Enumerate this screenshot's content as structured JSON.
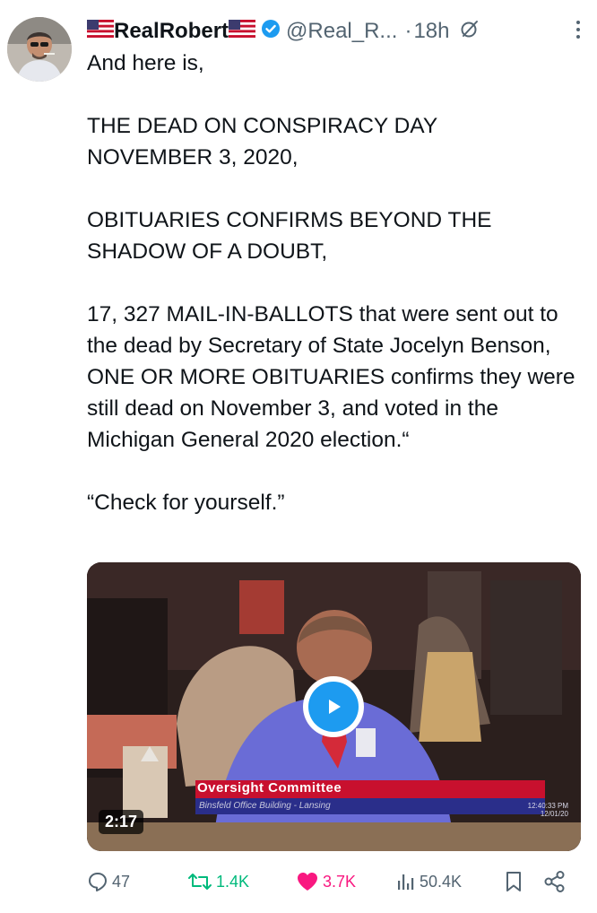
{
  "post": {
    "author": {
      "display_name": "RealRobert",
      "handle": "@Real_R...",
      "time": "18h",
      "separator": "·"
    },
    "text": {
      "line1": "And here is,",
      "para2": "THE DEAD ON CONSPIRACY DAY NOVEMBER 3, 2020,",
      "para3": "OBITUARIES CONFIRMS BEYOND THE SHADOW OF A DOUBT,",
      "para4": "17, 327 MAIL-IN-BALLOTS that were sent out to the dead by Secretary of State Jocelyn Benson, ONE OR MORE OBITUARIES confirms they were still dead on November 3, and voted in the Michigan General 2020 election.“",
      "para5": "“Check for yourself.”"
    },
    "video": {
      "duration": "2:17",
      "overlay_title": "Oversight Committee",
      "overlay_subtitle": "Binsfeld Office Building - Lansing",
      "overlay_clock": "12:40:33 PM",
      "overlay_date": "12/01/20"
    },
    "actions": {
      "replies": "47",
      "reposts": "1.4K",
      "likes": "3.7K",
      "views": "50.4K"
    }
  },
  "colors": {
    "text": "#0f1419",
    "muted": "#536471",
    "verified": "#1d9bf0",
    "like": "#f91880",
    "repost": "#00ba7c",
    "play": "#1d9bf0",
    "lower_third": "#c8102e"
  },
  "icons": {
    "more": "more-dots-icon",
    "grok": "grok-icon",
    "reply": "reply-bubble-icon",
    "repost": "repost-icon",
    "like": "heart-filled-icon",
    "views": "views-bars-icon",
    "bookmark": "bookmark-icon",
    "share": "share-icon",
    "play": "play-icon"
  }
}
